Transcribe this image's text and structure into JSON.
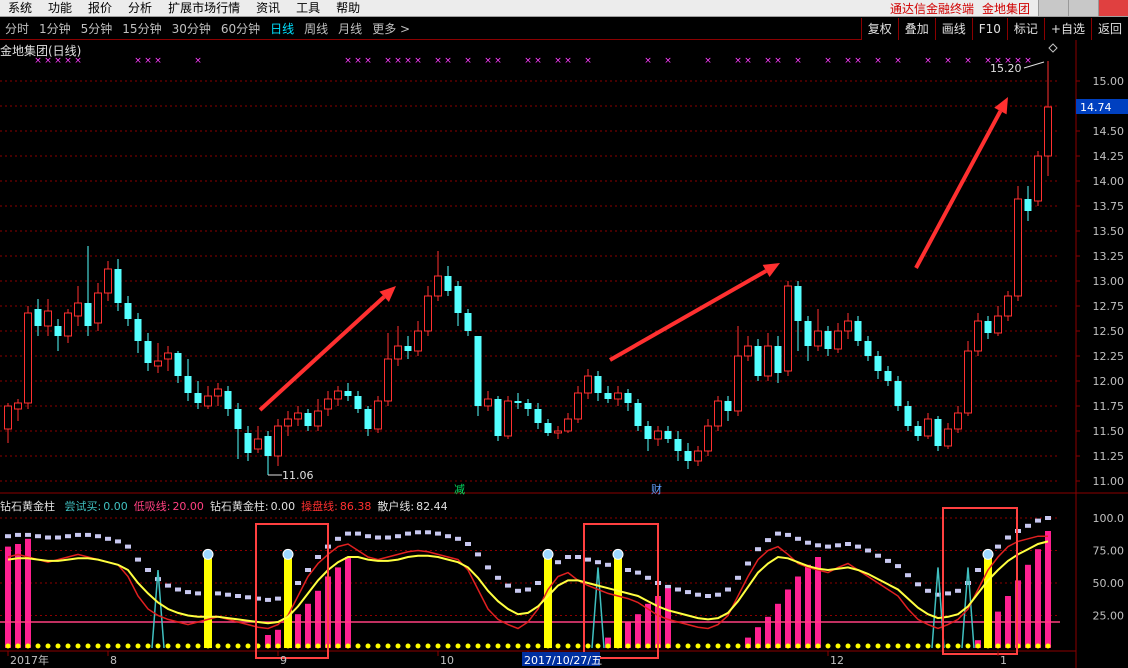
{
  "menu": {
    "items": [
      "系统",
      "功能",
      "报价",
      "分析",
      "扩展市场行情",
      "资讯",
      "工具",
      "帮助"
    ],
    "brand_app": "通达信金融终端",
    "brand_stock": "金地集团"
  },
  "periods": {
    "items": [
      "分时",
      "1分钟",
      "5分钟",
      "15分钟",
      "30分钟",
      "60分钟",
      "日线",
      "周线",
      "月线",
      "更多 >"
    ],
    "active_index": 6
  },
  "right_buttons": [
    "复权",
    "叠加",
    "画线",
    "F10",
    "标记",
    "+自选",
    "返回"
  ],
  "chart_title": "金地集团(日线)",
  "price_axis": {
    "ticks": [
      "15.00",
      "14.75",
      "14.50",
      "14.25",
      "14.00",
      "13.75",
      "13.50",
      "13.25",
      "13.00",
      "12.75",
      "12.50",
      "12.25",
      "12.00",
      "11.75",
      "11.50",
      "11.25",
      "11.00"
    ],
    "current_price": "14.74"
  },
  "annotations": {
    "high_label": "15.20",
    "low_label": "11.06",
    "marker_1": "减",
    "marker_2": "财"
  },
  "indicator": {
    "name": "钻石黄金柱",
    "items": [
      {
        "label": "尝试买:",
        "value": "0.00",
        "color": "#40c0c0"
      },
      {
        "label": "低吸线:",
        "value": "20.00",
        "color": "#ff4080"
      },
      {
        "label": "钻石黄金柱:",
        "value": "0.00",
        "color": "#e0e0e0"
      },
      {
        "label": "操盘线:",
        "value": "86.38",
        "color": "#ff3030"
      },
      {
        "label": "散户线:",
        "value": "82.44",
        "color": "#e0e0e0"
      }
    ],
    "axis_ticks": [
      "100.0",
      "75.00",
      "50.00",
      "25.00"
    ]
  },
  "date_axis": {
    "labels": [
      {
        "text": "2017年",
        "i": 0
      },
      {
        "text": "8",
        "i": 10
      },
      {
        "text": "9",
        "i": 27
      },
      {
        "text": "10",
        "i": 43
      },
      {
        "text": "2017/10/27/五",
        "i": 52,
        "highlight": true
      },
      {
        "text": "12",
        "i": 82
      },
      {
        "text": "1",
        "i": 99
      }
    ]
  },
  "colors": {
    "up": "#ff3030",
    "down": "#54ffff",
    "highlight_box": "#ff4040",
    "arrow": "#ff3030",
    "grid": "#8b0000"
  },
  "chart_data": {
    "type": "candlestick",
    "ylim": [
      11.0,
      15.2
    ],
    "candles": [
      [
        11.52,
        11.75,
        11.78,
        11.38
      ],
      [
        11.72,
        11.78,
        11.82,
        11.6
      ],
      [
        11.78,
        12.68,
        12.75,
        11.72
      ],
      [
        12.72,
        12.55,
        12.82,
        12.45
      ],
      [
        12.55,
        12.7,
        12.82,
        12.45
      ],
      [
        12.55,
        12.45,
        12.62,
        12.3
      ],
      [
        12.45,
        12.68,
        12.72,
        12.38
      ],
      [
        12.65,
        12.78,
        12.95,
        12.55
      ],
      [
        12.78,
        12.55,
        13.35,
        12.45
      ],
      [
        12.58,
        12.88,
        12.98,
        12.5
      ],
      [
        12.88,
        13.12,
        13.2,
        12.8
      ],
      [
        13.12,
        12.78,
        13.22,
        12.7
      ],
      [
        12.78,
        12.62,
        12.85,
        12.55
      ],
      [
        12.62,
        12.4,
        12.68,
        12.28
      ],
      [
        12.4,
        12.18,
        12.48,
        12.1
      ],
      [
        12.15,
        12.2,
        12.38,
        12.08
      ],
      [
        12.22,
        12.28,
        12.35,
        12.1
      ],
      [
        12.28,
        12.05,
        12.3,
        11.98
      ],
      [
        12.05,
        11.88,
        12.22,
        11.8
      ],
      [
        11.88,
        11.78,
        12.0,
        11.72
      ],
      [
        11.75,
        11.85,
        11.95,
        11.72
      ],
      [
        11.85,
        11.92,
        11.98,
        11.75
      ],
      [
        11.9,
        11.72,
        11.95,
        11.65
      ],
      [
        11.72,
        11.52,
        11.78,
        11.22
      ],
      [
        11.48,
        11.28,
        11.55,
        11.2
      ],
      [
        11.32,
        11.42,
        11.55,
        11.28
      ],
      [
        11.45,
        11.25,
        11.5,
        11.06
      ],
      [
        11.25,
        11.55,
        11.62,
        11.15
      ],
      [
        11.55,
        11.62,
        11.7,
        11.45
      ],
      [
        11.62,
        11.68,
        11.75,
        11.55
      ],
      [
        11.68,
        11.55,
        11.72,
        11.5
      ],
      [
        11.55,
        11.7,
        11.82,
        11.5
      ],
      [
        11.72,
        11.82,
        11.9,
        11.65
      ],
      [
        11.82,
        11.9,
        11.95,
        11.75
      ],
      [
        11.9,
        11.85,
        11.98,
        11.8
      ],
      [
        11.85,
        11.72,
        11.9,
        11.68
      ],
      [
        11.72,
        11.52,
        11.75,
        11.45
      ],
      [
        11.52,
        11.8,
        11.85,
        11.48
      ],
      [
        11.8,
        12.22,
        12.48,
        11.75
      ],
      [
        12.22,
        12.35,
        12.55,
        12.15
      ],
      [
        12.35,
        12.3,
        12.45,
        12.22
      ],
      [
        12.3,
        12.5,
        12.6,
        12.25
      ],
      [
        12.5,
        12.85,
        12.95,
        12.45
      ],
      [
        12.85,
        13.05,
        13.3,
        12.8
      ],
      [
        13.05,
        12.9,
        13.15,
        12.85
      ],
      [
        12.95,
        12.68,
        13.0,
        12.55
      ],
      [
        12.68,
        12.5,
        12.72,
        12.45
      ],
      [
        12.45,
        11.75,
        12.45,
        11.65
      ],
      [
        11.75,
        11.82,
        11.9,
        11.7
      ],
      [
        11.82,
        11.45,
        11.85,
        11.4
      ],
      [
        11.45,
        11.8,
        11.85,
        11.42
      ],
      [
        11.8,
        11.78,
        11.88,
        11.72
      ],
      [
        11.78,
        11.72,
        11.82,
        11.65
      ],
      [
        11.72,
        11.58,
        11.78,
        11.52
      ],
      [
        11.58,
        11.48,
        11.62,
        11.45
      ],
      [
        11.48,
        11.5,
        11.55,
        11.42
      ],
      [
        11.5,
        11.62,
        11.68,
        11.48
      ],
      [
        11.62,
        11.88,
        11.95,
        11.58
      ],
      [
        11.88,
        12.05,
        12.12,
        11.82
      ],
      [
        12.05,
        11.88,
        12.1,
        11.8
      ],
      [
        11.88,
        11.82,
        11.95,
        11.78
      ],
      [
        11.82,
        11.88,
        11.95,
        11.75
      ],
      [
        11.88,
        11.78,
        11.92,
        11.7
      ],
      [
        11.78,
        11.55,
        11.82,
        11.5
      ],
      [
        11.55,
        11.42,
        11.6,
        11.3
      ],
      [
        11.42,
        11.5,
        11.55,
        11.35
      ],
      [
        11.5,
        11.42,
        11.55,
        11.38
      ],
      [
        11.42,
        11.3,
        11.5,
        11.2
      ],
      [
        11.3,
        11.2,
        11.38,
        11.12
      ],
      [
        11.2,
        11.3,
        11.35,
        11.15
      ],
      [
        11.3,
        11.55,
        11.62,
        11.25
      ],
      [
        11.55,
        11.8,
        11.85,
        11.5
      ],
      [
        11.8,
        11.7,
        11.85,
        11.6
      ],
      [
        11.7,
        12.25,
        12.55,
        11.65
      ],
      [
        12.25,
        12.35,
        12.45,
        12.2
      ],
      [
        12.35,
        12.05,
        12.42,
        12.0
      ],
      [
        12.05,
        12.35,
        12.48,
        12.0
      ],
      [
        12.35,
        12.08,
        12.45,
        11.98
      ],
      [
        12.1,
        12.95,
        13.0,
        12.05
      ],
      [
        12.95,
        12.6,
        13.0,
        12.3
      ],
      [
        12.6,
        12.35,
        12.65,
        12.2
      ],
      [
        12.35,
        12.5,
        12.72,
        12.3
      ],
      [
        12.5,
        12.32,
        12.55,
        12.25
      ],
      [
        12.32,
        12.5,
        12.58,
        12.28
      ],
      [
        12.5,
        12.6,
        12.68,
        12.42
      ],
      [
        12.6,
        12.4,
        12.65,
        12.35
      ],
      [
        12.4,
        12.25,
        12.45,
        12.2
      ],
      [
        12.25,
        12.1,
        12.3,
        12.02
      ],
      [
        12.1,
        12.0,
        12.15,
        11.95
      ],
      [
        12.0,
        11.75,
        12.05,
        11.7
      ],
      [
        11.75,
        11.55,
        11.8,
        11.5
      ],
      [
        11.55,
        11.45,
        11.6,
        11.4
      ],
      [
        11.45,
        11.62,
        11.68,
        11.42
      ],
      [
        11.62,
        11.35,
        11.65,
        11.3
      ],
      [
        11.35,
        11.52,
        11.58,
        11.32
      ],
      [
        11.52,
        11.68,
        11.75,
        11.48
      ],
      [
        11.68,
        12.3,
        12.4,
        11.65
      ],
      [
        12.3,
        12.6,
        12.68,
        12.25
      ],
      [
        12.6,
        12.48,
        12.65,
        12.42
      ],
      [
        12.48,
        12.65,
        12.75,
        12.45
      ],
      [
        12.65,
        12.85,
        12.9,
        12.6
      ],
      [
        12.85,
        13.82,
        13.95,
        12.8
      ],
      [
        13.82,
        13.7,
        13.95,
        13.6
      ],
      [
        13.8,
        14.25,
        14.3,
        13.75
      ],
      [
        14.25,
        14.74,
        15.2,
        14.05
      ]
    ],
    "indicator": {
      "ylim": [
        0,
        100
      ],
      "caopan": [
        70,
        72,
        70,
        68,
        66,
        68,
        70,
        72,
        70,
        68,
        66,
        64,
        55,
        40,
        30,
        25,
        22,
        20,
        18,
        20,
        22,
        24,
        22,
        20,
        18,
        16,
        15,
        18,
        25,
        40,
        55,
        65,
        72,
        78,
        80,
        75,
        70,
        68,
        70,
        72,
        74,
        75,
        74,
        72,
        70,
        68,
        60,
        45,
        30,
        22,
        18,
        15,
        20,
        30,
        45,
        55,
        58,
        52,
        48,
        45,
        42,
        40,
        38,
        35,
        30,
        25,
        22,
        20,
        18,
        16,
        15,
        18,
        25,
        40,
        55,
        68,
        75,
        78,
        72,
        65,
        62,
        60,
        58,
        62,
        65,
        60,
        55,
        50,
        45,
        40,
        30,
        22,
        18,
        15,
        18,
        22,
        30,
        45,
        60,
        70,
        78,
        82,
        84,
        86,
        86
      ],
      "sanhu": [
        68,
        69,
        69,
        68,
        67,
        67,
        68,
        69,
        69,
        68,
        66,
        64,
        60,
        50,
        42,
        35,
        30,
        27,
        25,
        24,
        24,
        24,
        23,
        22,
        21,
        20,
        19,
        20,
        24,
        32,
        42,
        52,
        60,
        66,
        70,
        70,
        68,
        67,
        67,
        68,
        70,
        71,
        71,
        70,
        68,
        66,
        62,
        54,
        44,
        36,
        30,
        26,
        27,
        32,
        40,
        48,
        52,
        52,
        50,
        48,
        46,
        44,
        42,
        40,
        36,
        32,
        29,
        27,
        25,
        23,
        22,
        23,
        27,
        36,
        47,
        58,
        65,
        70,
        69,
        66,
        63,
        61,
        60,
        61,
        62,
        60,
        57,
        53,
        49,
        45,
        38,
        31,
        26,
        23,
        24,
        26,
        32,
        42,
        52,
        60,
        67,
        72,
        76,
        80,
        82
      ]
    }
  }
}
